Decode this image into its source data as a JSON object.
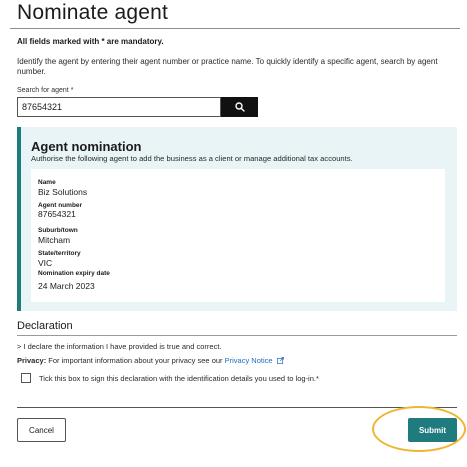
{
  "page": {
    "title": "Nominate agent",
    "mandatory_note": "All fields marked with * are mandatory.",
    "intro": "Identify the agent by entering their agent number or practice name. To quickly identify a specific agent, search by agent number."
  },
  "search": {
    "label": "Search for agent *",
    "value": "87654321",
    "button_icon": "search-icon"
  },
  "nomination": {
    "title": "Agent nomination",
    "subtitle": "Authorise the following agent to add the business as a client or manage additional tax accounts.",
    "fields": [
      {
        "label": "Name",
        "value": "Biz Solutions"
      },
      {
        "label": "Agent number",
        "value": "87654321"
      },
      {
        "label": "Suburb/town",
        "value": "Mitcham"
      },
      {
        "label": "State/territory",
        "value": "VIC"
      },
      {
        "label": "Nomination expiry date",
        "value": "24 March 2023"
      }
    ]
  },
  "declaration": {
    "title": "Declaration",
    "statement": "> I declare the information I have provided is true and correct.",
    "privacy_label": "Privacy:",
    "privacy_text": "For important information about your privacy see our",
    "privacy_link": "Privacy Notice",
    "checkbox_label": "Tick this box to sign this declaration with the identification details you used to log-in.*",
    "checkbox_checked": false
  },
  "actions": {
    "cancel_label": "Cancel",
    "submit_label": "Submit"
  },
  "colors": {
    "accent": "#1f7b7e",
    "panel_bg": "#e8f4f6",
    "link": "#1f6bbf",
    "highlight": "#f0b52f"
  }
}
